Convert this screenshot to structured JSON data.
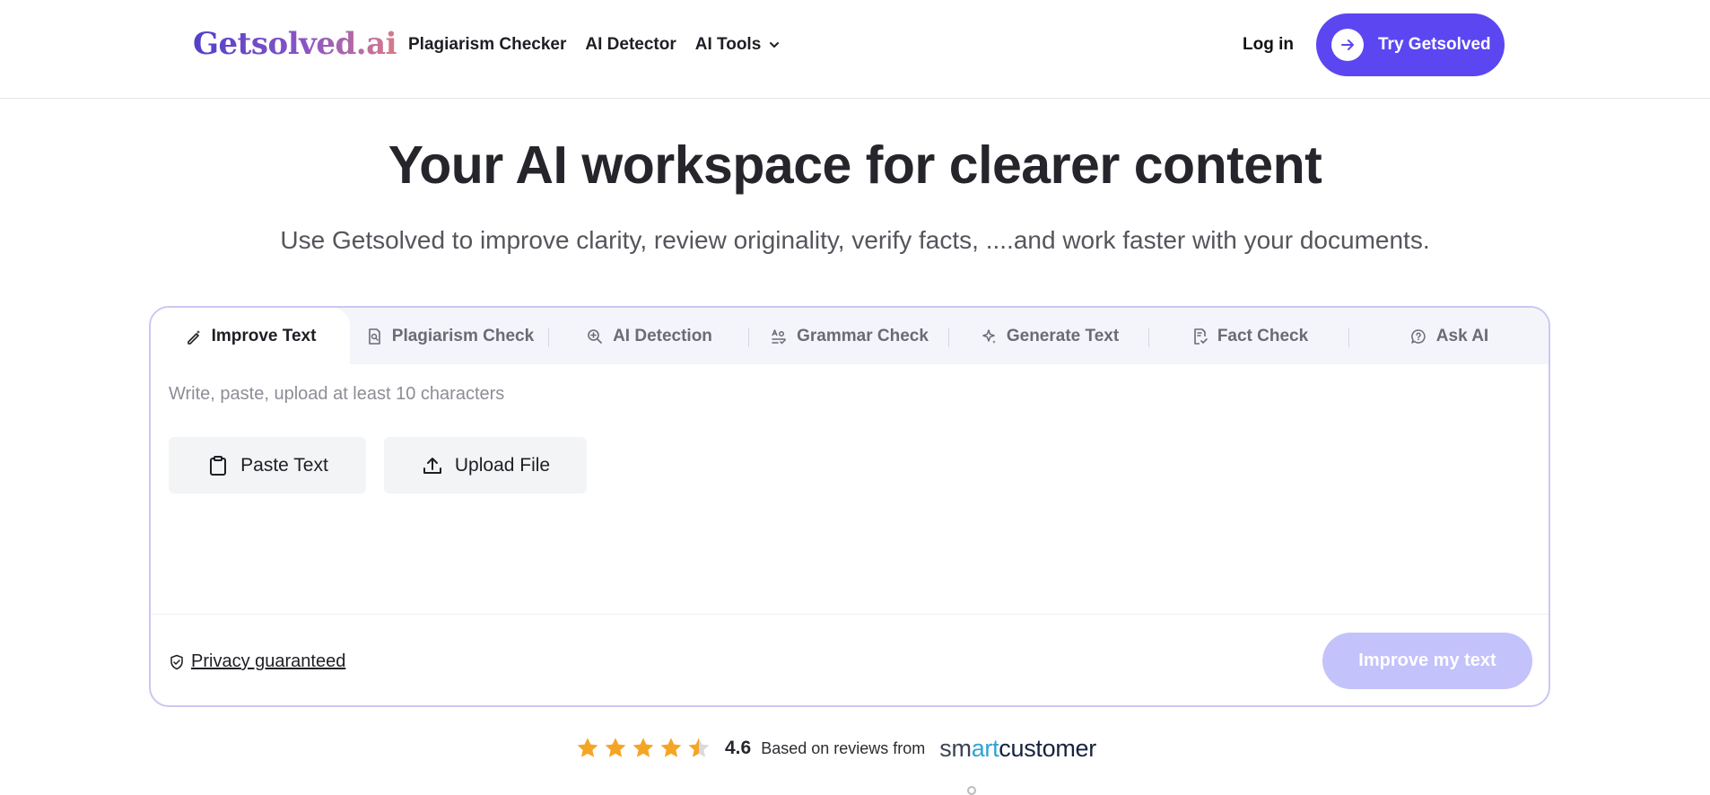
{
  "header": {
    "logo": "Getsolved.ai",
    "nav": [
      {
        "label": "Plagiarism Checker"
      },
      {
        "label": "AI Detector"
      },
      {
        "label": "AI Tools"
      }
    ],
    "login": "Log in",
    "cta": "Try Getsolved"
  },
  "hero": {
    "title": "Your AI workspace for clearer content",
    "subtitle": "Use Getsolved to improve clarity, review originality, verify facts, ....and work faster with your documents."
  },
  "tool": {
    "tabs": [
      {
        "label": "Improve Text",
        "icon": "pen-sparkle-icon",
        "active": true
      },
      {
        "label": "Plagiarism Check",
        "icon": "doc-search-icon"
      },
      {
        "label": "AI Detection",
        "icon": "magnifier-plus-icon"
      },
      {
        "label": "Grammar Check",
        "icon": "grammar-icon"
      },
      {
        "label": "Generate Text",
        "icon": "sparkle-icon"
      },
      {
        "label": "Fact Check",
        "icon": "doc-check-icon"
      },
      {
        "label": "Ask AI",
        "icon": "chat-question-icon"
      }
    ],
    "placeholder": "Write, paste, upload at least 10 characters",
    "paste_label": "Paste Text",
    "upload_label": "Upload File",
    "privacy": "Privacy guaranteed",
    "submit": "Improve my text"
  },
  "rating": {
    "value": "4.6",
    "stars": 4.5,
    "text": "Based on reviews from",
    "brand_prefix": "sm",
    "brand_mid": "art",
    "brand_suffix": "customer"
  },
  "colors": {
    "primary": "#5b46f2",
    "primary_disabled": "#c4c2fb",
    "card_border": "#c9c8f3",
    "star": "#f5a524"
  }
}
